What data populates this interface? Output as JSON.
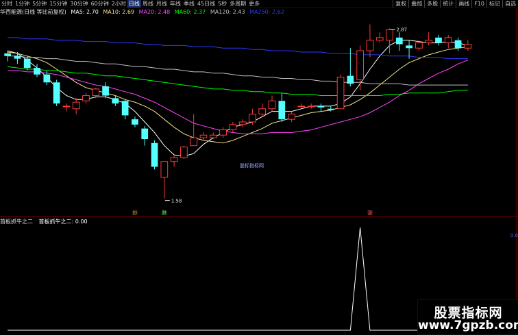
{
  "toolbar": {
    "timeframes": [
      "分时",
      "1分钟",
      "5分钟",
      "15分钟",
      "30分钟",
      "60分钟",
      "2小时",
      "日线",
      "周线",
      "月线",
      "年线",
      "季线",
      "45日线",
      "5秒",
      "多周期",
      "更多"
    ],
    "active_index": 7,
    "right_buttons": [
      "复权",
      "叠加",
      "多股",
      "统计",
      "画线",
      "F10",
      "标记",
      "自选"
    ]
  },
  "info": {
    "stock": "华西能源(日线 等比前复权)",
    "ma5": "MA5: 2.70",
    "ma10": "MA10: 2.69",
    "ma20": "MA20: 2.48",
    "ma60": "MA60: 2.37",
    "ma120": "MA120: 2.43",
    "ma250": "MA250: 2.62"
  },
  "sub": {
    "name": "首板抓牛之二",
    "value": "首板抓牛之二: 0.00"
  },
  "labels": {
    "high": "2.87",
    "low": "1.58",
    "sig_buy": "抄",
    "sig_green": "跌",
    "sig_red": "涨",
    "center_watermark": "股标指标网",
    "right_value": "0.0"
  },
  "watermark": {
    "title": "股票指标网",
    "url": "www.7gpzb.com"
  },
  "colors": {
    "up": "#ff3b3b",
    "down": "#54ffff",
    "ma5": "#ffffff",
    "ma10": "#f0e68c",
    "ma20": "#ff44ff",
    "ma60": "#00ff00",
    "ma120": "#c0c0c0",
    "ma250": "#2b3bff"
  },
  "chart_data": {
    "type": "candlestick",
    "ohlc": [
      [
        2.68,
        2.7,
        2.62,
        2.66
      ],
      [
        2.66,
        2.69,
        2.6,
        2.64
      ],
      [
        2.64,
        2.66,
        2.55,
        2.57
      ],
      [
        2.57,
        2.6,
        2.5,
        2.52
      ],
      [
        2.52,
        2.55,
        2.44,
        2.46
      ],
      [
        2.46,
        2.48,
        2.28,
        2.3
      ],
      [
        2.28,
        2.3,
        2.24,
        2.28
      ],
      [
        2.26,
        2.34,
        2.22,
        2.31
      ],
      [
        2.32,
        2.38,
        2.3,
        2.36
      ],
      [
        2.36,
        2.42,
        2.34,
        2.41
      ],
      [
        2.43,
        2.46,
        2.34,
        2.36
      ],
      [
        2.34,
        2.36,
        2.28,
        2.3
      ],
      [
        2.32,
        2.33,
        2.18,
        2.21
      ],
      [
        2.18,
        2.2,
        2.12,
        2.14
      ],
      [
        2.11,
        2.13,
        1.98,
        2.03
      ],
      [
        2.0,
        2.02,
        1.8,
        1.82
      ],
      [
        1.74,
        1.86,
        1.58,
        1.86
      ],
      [
        1.86,
        1.91,
        1.82,
        1.89
      ],
      [
        1.89,
        1.98,
        1.88,
        1.97
      ],
      [
        1.98,
        2.22,
        1.98,
        2.04
      ],
      [
        2.04,
        2.08,
        2.02,
        2.06
      ],
      [
        2.04,
        2.08,
        2.03,
        2.06
      ],
      [
        2.06,
        2.12,
        2.04,
        2.1
      ],
      [
        2.1,
        2.16,
        2.08,
        2.14
      ],
      [
        2.14,
        2.18,
        2.12,
        2.16
      ],
      [
        2.16,
        2.26,
        2.14,
        2.22
      ],
      [
        2.22,
        2.3,
        2.2,
        2.26
      ],
      [
        2.26,
        2.36,
        2.24,
        2.32
      ],
      [
        2.32,
        2.38,
        2.16,
        2.18
      ],
      [
        2.18,
        2.24,
        2.16,
        2.22
      ],
      [
        2.28,
        2.3,
        2.26,
        2.28
      ],
      [
        2.28,
        2.3,
        2.26,
        2.28
      ],
      [
        2.28,
        2.3,
        2.24,
        2.27
      ],
      [
        2.26,
        2.28,
        2.24,
        2.25
      ],
      [
        2.26,
        2.52,
        2.26,
        2.5
      ],
      [
        2.51,
        2.72,
        2.43,
        2.45
      ],
      [
        2.48,
        2.74,
        2.4,
        2.7
      ],
      [
        2.7,
        2.9,
        2.65,
        2.78
      ],
      [
        2.78,
        2.84,
        2.76,
        2.8
      ],
      [
        2.78,
        2.87,
        2.68,
        2.86
      ],
      [
        2.8,
        2.84,
        2.7,
        2.75
      ],
      [
        2.74,
        2.78,
        2.64,
        2.72
      ],
      [
        2.72,
        2.78,
        2.7,
        2.76
      ],
      [
        2.76,
        2.84,
        2.74,
        2.78
      ],
      [
        2.8,
        2.82,
        2.74,
        2.76
      ],
      [
        2.76,
        2.82,
        2.72,
        2.8
      ],
      [
        2.78,
        2.8,
        2.7,
        2.72
      ],
      [
        2.72,
        2.78,
        2.7,
        2.75
      ]
    ],
    "ma_lines": [
      {
        "name": "MA5",
        "color": "#ffffff",
        "values": [
          2.7,
          2.68,
          2.63,
          2.57,
          2.5,
          2.42,
          2.36,
          2.33,
          2.33,
          2.35,
          2.35,
          2.33,
          2.3,
          2.24,
          2.16,
          2.08,
          1.98,
          1.91,
          1.9,
          1.92,
          1.99,
          2.04,
          2.08,
          2.12,
          2.14,
          2.16,
          2.2,
          2.24,
          2.24,
          2.24,
          2.26,
          2.28,
          2.28,
          2.28,
          2.3,
          2.35,
          2.45,
          2.56,
          2.66,
          2.74,
          2.78,
          2.78,
          2.77,
          2.76,
          2.76,
          2.77,
          2.76,
          2.74
        ]
      },
      {
        "name": "MA10",
        "color": "#f0e68c",
        "values": [
          2.69,
          2.68,
          2.66,
          2.64,
          2.61,
          2.56,
          2.51,
          2.46,
          2.42,
          2.4,
          2.38,
          2.36,
          2.33,
          2.31,
          2.28,
          2.24,
          2.18,
          2.12,
          2.07,
          2.04,
          2.02,
          2.01,
          2.0,
          2.02,
          2.05,
          2.08,
          2.11,
          2.15,
          2.17,
          2.19,
          2.21,
          2.23,
          2.24,
          2.25,
          2.27,
          2.29,
          2.33,
          2.38,
          2.44,
          2.5,
          2.56,
          2.61,
          2.64,
          2.67,
          2.69,
          2.71,
          2.72,
          2.73
        ]
      },
      {
        "name": "MA20",
        "color": "#ff44ff",
        "values": [
          2.55,
          2.55,
          2.54,
          2.54,
          2.53,
          2.52,
          2.5,
          2.48,
          2.46,
          2.44,
          2.43,
          2.41,
          2.39,
          2.37,
          2.34,
          2.31,
          2.27,
          2.23,
          2.19,
          2.15,
          2.13,
          2.11,
          2.09,
          2.08,
          2.07,
          2.07,
          2.07,
          2.08,
          2.08,
          2.08,
          2.09,
          2.1,
          2.12,
          2.14,
          2.16,
          2.18,
          2.2,
          2.23,
          2.27,
          2.31,
          2.36,
          2.4,
          2.45,
          2.49,
          2.53,
          2.56,
          2.6,
          2.63
        ]
      },
      {
        "name": "MA60",
        "color": "#00ff00",
        "values": [
          2.58,
          2.57,
          2.56,
          2.56,
          2.55,
          2.55,
          2.54,
          2.53,
          2.53,
          2.52,
          2.51,
          2.51,
          2.5,
          2.49,
          2.48,
          2.47,
          2.46,
          2.45,
          2.44,
          2.43,
          2.42,
          2.41,
          2.41,
          2.4,
          2.4,
          2.39,
          2.39,
          2.38,
          2.38,
          2.37,
          2.37,
          2.37,
          2.36,
          2.36,
          2.36,
          2.36,
          2.36,
          2.36,
          2.36,
          2.37,
          2.37,
          2.38,
          2.38,
          2.38,
          2.38,
          2.39,
          2.4,
          2.4
        ]
      },
      {
        "name": "MA120",
        "color": "#c0c0c0",
        "values": [
          2.66,
          2.66,
          2.65,
          2.65,
          2.64,
          2.64,
          2.63,
          2.62,
          2.62,
          2.61,
          2.6,
          2.6,
          2.59,
          2.58,
          2.58,
          2.57,
          2.56,
          2.56,
          2.55,
          2.54,
          2.54,
          2.53,
          2.53,
          2.52,
          2.51,
          2.51,
          2.5,
          2.5,
          2.49,
          2.49,
          2.48,
          2.48,
          2.47,
          2.47,
          2.46,
          2.46,
          2.46,
          2.45,
          2.45,
          2.45,
          2.45,
          2.44,
          2.44,
          2.44,
          2.44,
          2.44,
          2.44,
          2.44
        ]
      },
      {
        "name": "MA250",
        "color": "#2b3bff",
        "values": [
          2.8,
          2.8,
          2.79,
          2.79,
          2.79,
          2.78,
          2.78,
          2.78,
          2.77,
          2.77,
          2.77,
          2.76,
          2.76,
          2.76,
          2.75,
          2.75,
          2.74,
          2.74,
          2.74,
          2.73,
          2.73,
          2.73,
          2.72,
          2.72,
          2.72,
          2.71,
          2.71,
          2.7,
          2.7,
          2.7,
          2.69,
          2.69,
          2.69,
          2.68,
          2.68,
          2.68,
          2.67,
          2.67,
          2.67,
          2.66,
          2.66,
          2.66,
          2.65,
          2.65,
          2.65,
          2.64,
          2.64,
          2.64
        ]
      }
    ],
    "price_range": [
      1.5,
      2.95
    ],
    "indicator": {
      "name": "首板抓牛之二",
      "values": [
        0,
        0,
        0,
        0,
        0,
        0,
        0,
        0,
        0,
        0,
        0,
        0,
        0,
        0,
        0,
        0,
        0,
        0,
        0,
        0,
        0,
        0,
        0,
        0,
        0,
        0,
        0,
        0,
        0,
        0,
        0,
        0,
        0,
        0,
        0,
        0,
        1,
        0,
        0,
        0,
        0,
        0,
        0,
        0,
        0,
        0,
        0,
        0
      ],
      "ylim": [
        0,
        1
      ]
    },
    "signals": [
      {
        "index": 13,
        "text": "抄",
        "color": "#ff9a00"
      },
      {
        "index": 16,
        "text": "跌",
        "color": "#4cff4c"
      },
      {
        "index": 37,
        "text": "涨",
        "color": "#ff4c4c"
      }
    ],
    "annotations": [
      {
        "index": 39,
        "value": 2.87,
        "text": "2.87"
      },
      {
        "index": 16,
        "value": 1.58,
        "text": "1.58"
      }
    ]
  }
}
